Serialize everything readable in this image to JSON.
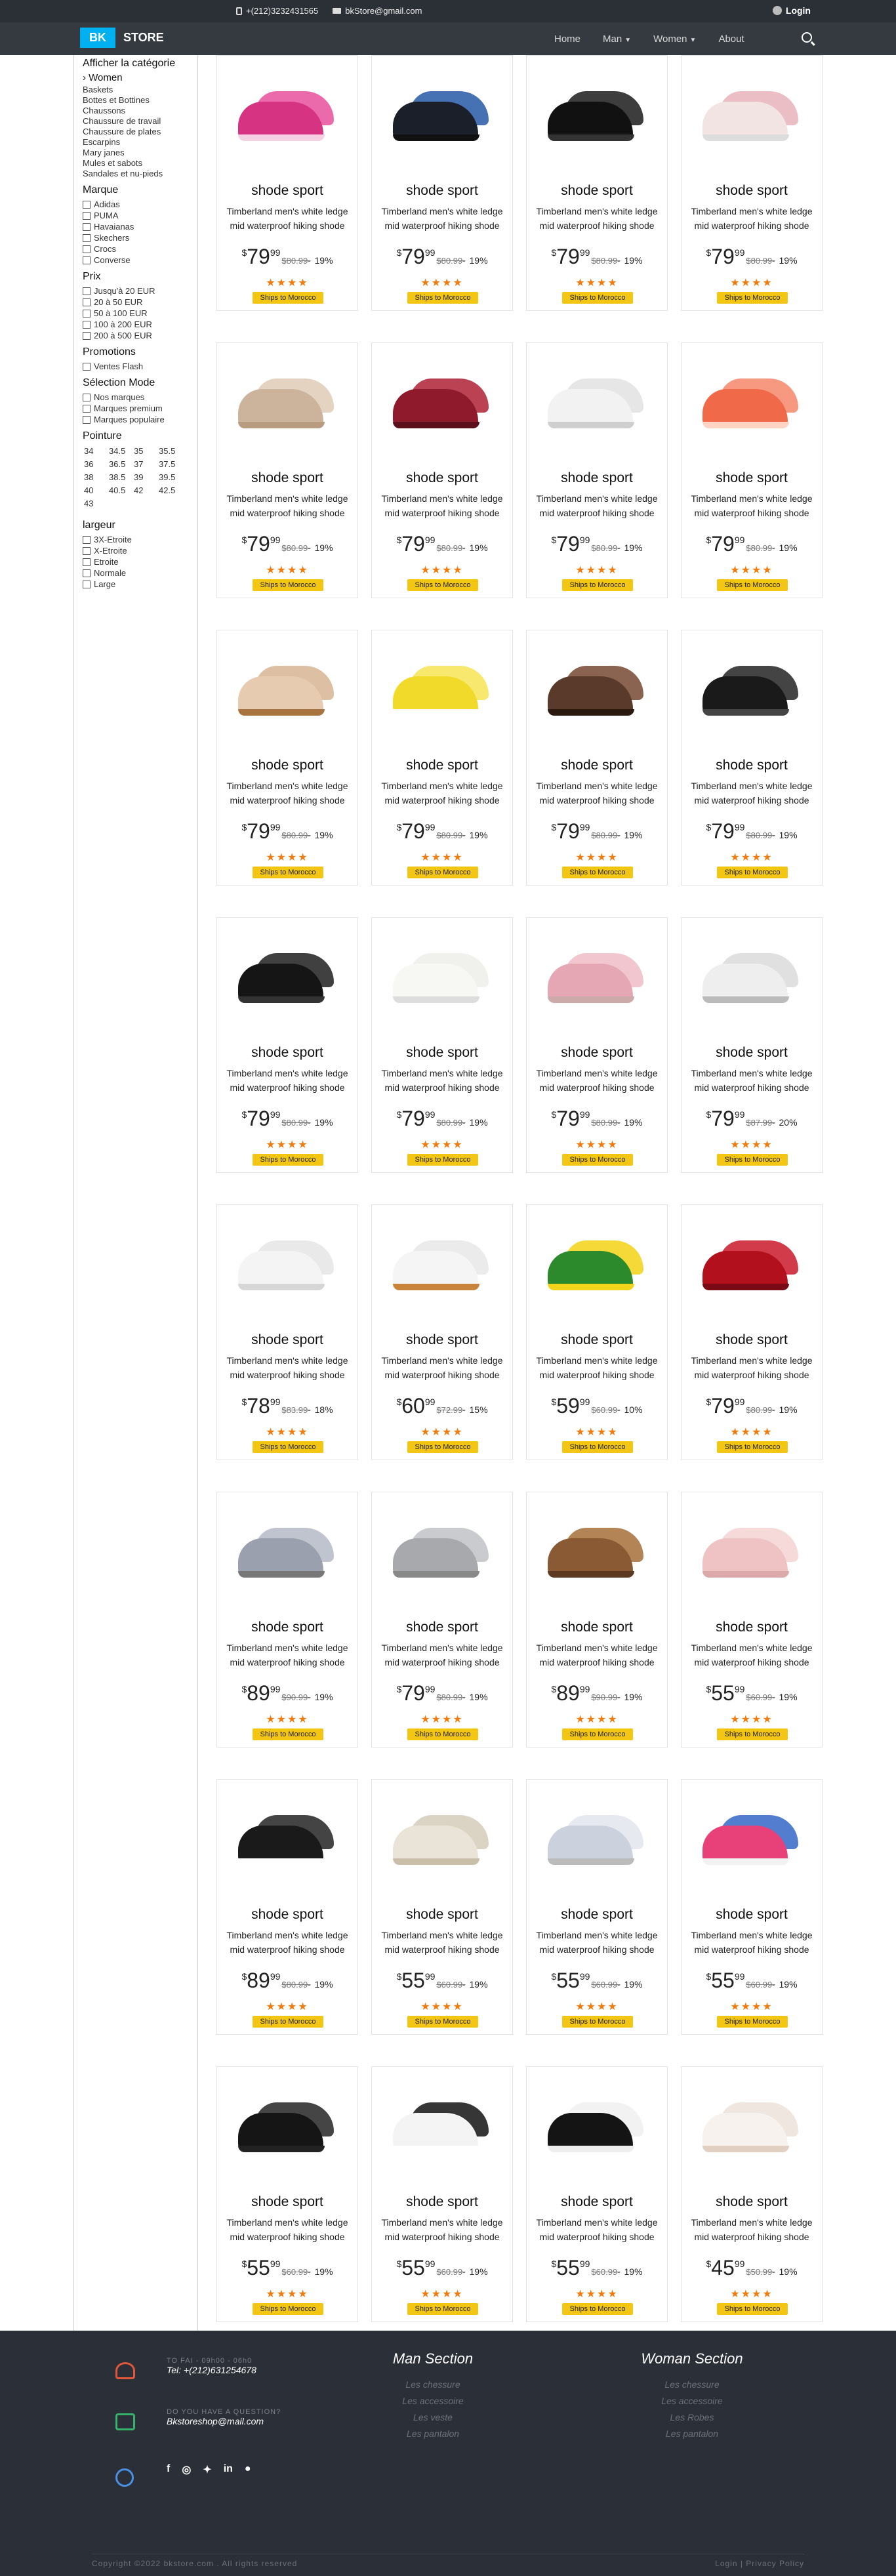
{
  "topbar": {
    "phone": "+(212)3232431565",
    "email": "bkStore@gmail.com",
    "login": "Login"
  },
  "nav": {
    "brand_a": "BK",
    "brand_b": "STORE",
    "links": [
      {
        "label": "Home"
      },
      {
        "label": "Man"
      },
      {
        "label": "Women"
      },
      {
        "label": "About"
      }
    ]
  },
  "sidebar": {
    "heading": "Afficher la catégorie",
    "current": "› Women",
    "categories": [
      "Baskets",
      "Bottes et Bottines",
      "Chaussons",
      "Chaussure de travail",
      "Chaussure de plates",
      "Escarpins",
      "Mary janes",
      "Mules et sabots",
      "Sandales et nu-pieds"
    ],
    "marque_title": "Marque",
    "marque": [
      "Adidas",
      "PUMA",
      "Havaianas",
      "Skechers",
      "Crocs",
      "Converse"
    ],
    "prix_title": "Prix",
    "prix": [
      "Jusqu'à 20 EUR",
      "20 à 50 EUR",
      "50 à 100 EUR",
      "100 à 200 EUR",
      "200 à 500 EUR"
    ],
    "promo_title": "Promotions",
    "promo": [
      "Ventes Flash"
    ],
    "mode_title": "Sélection Mode",
    "mode": [
      "Nos marques",
      "Marques premium",
      "Marques populaire"
    ],
    "pointure_title": "Pointure",
    "sizes": [
      "34",
      "34.5",
      "35",
      "35.5",
      "36",
      "36.5",
      "37",
      "37.5",
      "38",
      "38.5",
      "39",
      "39.5",
      "40",
      "40.5",
      "42",
      "42.5",
      "43"
    ],
    "largeur_title": "largeur",
    "largeur": [
      "3X-Etroite",
      "X-Etroite",
      "Etroite",
      "Normale",
      "Large"
    ]
  },
  "product_common": {
    "title": "shode sport",
    "desc": "Timberland men's white ledge mid waterproof hiking shode",
    "ship": "Ships to Morocco",
    "stars": "★★★★"
  },
  "products": [
    {
      "price": "79",
      "cents": "99",
      "old": "$80.99-",
      "disc": "19%",
      "c1": "#d63383",
      "c2": "#e855a0",
      "sole": "#f5d0e3"
    },
    {
      "price": "79",
      "cents": "99",
      "old": "$80.99-",
      "disc": "19%",
      "c1": "#1b1f2a",
      "c2": "#2c5fa8",
      "sole": "#111"
    },
    {
      "price": "79",
      "cents": "99",
      "old": "$80.99-",
      "disc": "19%",
      "c1": "#111111",
      "c2": "#222222",
      "sole": "#333"
    },
    {
      "price": "79",
      "cents": "99",
      "old": "$80.99-",
      "disc": "19%",
      "c1": "#f3e4e4",
      "c2": "#e8b4bc",
      "sole": "#ddd"
    },
    {
      "price": "79",
      "cents": "99",
      "old": "$80.99-",
      "disc": "19%",
      "c1": "#cbb49b",
      "c2": "#e0cdb8",
      "sole": "#b89c80"
    },
    {
      "price": "79",
      "cents": "99",
      "old": "$80.99-",
      "disc": "19%",
      "c1": "#8e1a2b",
      "c2": "#b0283a",
      "sole": "#5a0f1a"
    },
    {
      "price": "79",
      "cents": "99",
      "old": "$80.99-",
      "disc": "19%",
      "c1": "#f2f2f2",
      "c2": "#e2e2e2",
      "sole": "#cfcfcf"
    },
    {
      "price": "79",
      "cents": "99",
      "old": "$80.99-",
      "disc": "19%",
      "c1": "#f06a4a",
      "c2": "#f58b6e",
      "sole": "#ffd4c4"
    },
    {
      "price": "79",
      "cents": "99",
      "old": "$80.99-",
      "disc": "19%",
      "c1": "#e7cbb1",
      "c2": "#d8b697",
      "sole": "#a8743f"
    },
    {
      "price": "79",
      "cents": "99",
      "old": "$80.99-",
      "disc": "19%",
      "c1": "#f2da2a",
      "c2": "#f7e65a",
      "sole": "#ffffff"
    },
    {
      "price": "79",
      "cents": "99",
      "old": "$80.99-",
      "disc": "19%",
      "c1": "#5a3a2a",
      "c2": "#7a4f38",
      "sole": "#2a1a10"
    },
    {
      "price": "79",
      "cents": "99",
      "old": "$80.99-",
      "disc": "19%",
      "c1": "#1a1a1a",
      "c2": "#2a2a2a",
      "sole": "#444"
    },
    {
      "price": "79",
      "cents": "99",
      "old": "$80.99-",
      "disc": "19%",
      "c1": "#151515",
      "c2": "#262626",
      "sole": "#333"
    },
    {
      "price": "79",
      "cents": "99",
      "old": "$80.99-",
      "disc": "19%",
      "c1": "#f7f7f4",
      "c2": "#eeeeea",
      "sole": "#ddd"
    },
    {
      "price": "79",
      "cents": "99",
      "old": "$80.99-",
      "disc": "19%",
      "c1": "#e6a7b4",
      "c2": "#f0bec8",
      "sole": "#caa"
    },
    {
      "price": "79",
      "cents": "99",
      "old": "$87.99-",
      "disc": "20%",
      "c1": "#eeeeee",
      "c2": "#dcdcdc",
      "sole": "#bbb"
    },
    {
      "price": "78",
      "cents": "99",
      "old": "$83.99-",
      "disc": "18%",
      "c1": "#f4f4f4",
      "c2": "#e6e6e6",
      "sole": "#d6d6d6"
    },
    {
      "price": "60",
      "cents": "99",
      "old": "$72.99-",
      "disc": "15%",
      "c1": "#f5f5f5",
      "c2": "#e8e8e8",
      "sole": "#c8843b"
    },
    {
      "price": "59",
      "cents": "99",
      "old": "$60.99-",
      "disc": "10%",
      "c1": "#2c8a2c",
      "c2": "#f2d41c",
      "sole": "#f2d41c"
    },
    {
      "price": "79",
      "cents": "99",
      "old": "$80.99-",
      "disc": "19%",
      "c1": "#b2101d",
      "c2": "#cc2030",
      "sole": "#7a0a14"
    },
    {
      "price": "89",
      "cents": "99",
      "old": "$90.99-",
      "disc": "19%",
      "c1": "#9aa0ad",
      "c2": "#b7bcc8",
      "sole": "#777"
    },
    {
      "price": "79",
      "cents": "99",
      "old": "$80.99-",
      "disc": "19%",
      "c1": "#a7a9ad",
      "c2": "#c2c4c8",
      "sole": "#888"
    },
    {
      "price": "89",
      "cents": "99",
      "old": "$90.99-",
      "disc": "19%",
      "c1": "#8a5a34",
      "c2": "#a9743f",
      "sole": "#5a3a20"
    },
    {
      "price": "55",
      "cents": "99",
      "old": "$60.99-",
      "disc": "19%",
      "c1": "#efc3c3",
      "c2": "#f5d4d4",
      "sole": "#dba9a9"
    },
    {
      "price": "89",
      "cents": "99",
      "old": "$80.99-",
      "disc": "19%",
      "c1": "#1a1a1a",
      "c2": "#2a2a2a",
      "sole": "#fff"
    },
    {
      "price": "55",
      "cents": "99",
      "old": "$60.99-",
      "disc": "19%",
      "c1": "#eae4d8",
      "c2": "#d6cdbb",
      "sole": "#c9bea8"
    },
    {
      "price": "55",
      "cents": "99",
      "old": "$60.99-",
      "disc": "19%",
      "c1": "#cbd2de",
      "c2": "#e2e6ee",
      "sole": "#bbb"
    },
    {
      "price": "55",
      "cents": "99",
      "old": "$60.99-",
      "disc": "19%",
      "c1": "#e8417a",
      "c2": "#3b6bc7",
      "sole": "#f2f2f2"
    },
    {
      "price": "55",
      "cents": "99",
      "old": "$60.99-",
      "disc": "19%",
      "c1": "#151515",
      "c2": "#2b2b2b",
      "sole": "#222"
    },
    {
      "price": "55",
      "cents": "99",
      "old": "$60.99-",
      "disc": "19%",
      "c1": "#f4f4f4",
      "c2": "#1a1a1a",
      "sole": "#fff"
    },
    {
      "price": "55",
      "cents": "99",
      "old": "$60.99-",
      "disc": "19%",
      "c1": "#141414",
      "c2": "#f0f0f0",
      "sole": "#eee"
    },
    {
      "price": "45",
      "cents": "99",
      "old": "$50.99-",
      "disc": "19%",
      "c1": "#f7f2ee",
      "c2": "#ede3db",
      "sole": "#e1cfc2"
    }
  ],
  "footer": {
    "tel_label": "TO FAI - 09h00 - 06h0",
    "tel": "Tel: +(212)631254678",
    "mail_label": "DO YOU HAVE A QUESTION?",
    "mail": "Bkstoreshop@mail.com",
    "man_title": "Man Section",
    "man_links": [
      "Les chessure",
      "Les accessoire",
      "Les veste",
      "Les pantalon"
    ],
    "woman_title": "Woman Section",
    "woman_links": [
      "Les chessure",
      "Les accessoire",
      "Les Robes",
      "Les pantalon"
    ],
    "copyright": "Copyright ©2022 bkstore.com . All rights reserved",
    "bottom_links": "Login  |  Privacy Policy",
    "colors": {
      "phone": "#e0573a",
      "mail": "#35b36a",
      "share": "#4a90e2"
    }
  }
}
